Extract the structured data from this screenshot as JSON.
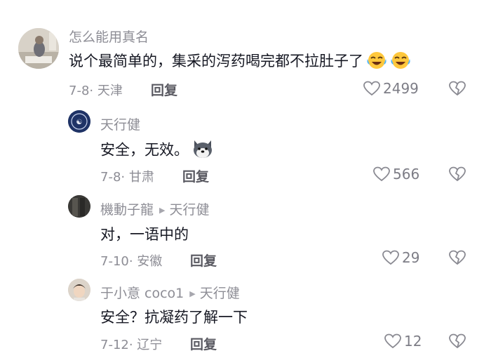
{
  "comments": [
    {
      "username": "怎么能用真名",
      "text": "说个最简单的，集采的泻药喝完都不拉肚子了",
      "emojis": [
        "laughing-crying-emoji",
        "laughing-crying-emoji"
      ],
      "meta": "7-8· 天津",
      "reply_label": "回复",
      "likes": "2499"
    },
    {
      "username": "天行健",
      "text": "安全，无效。",
      "emojis": [
        "husky-emoji"
      ],
      "meta": "7-8· 甘肃",
      "reply_label": "回复",
      "likes": "566"
    },
    {
      "username": "機動子龍",
      "reply_to": "天行健",
      "text": "对，一语中的",
      "meta": "7-10· 安徽",
      "reply_label": "回复",
      "likes": "29"
    },
    {
      "username": "于小意 coco1",
      "reply_to": "天行健",
      "text": "安全？抗凝药了解一下",
      "meta": "7-12· 辽宁",
      "reply_label": "回复",
      "likes": "12"
    }
  ],
  "colors": {
    "text": "#161823",
    "secondary": "#8d8d95",
    "reply": "#5a5a62",
    "background": "#ffffff"
  },
  "icons": [
    "like-heart-icon",
    "dislike-broken-heart-icon",
    "reply-arrow-icon"
  ]
}
